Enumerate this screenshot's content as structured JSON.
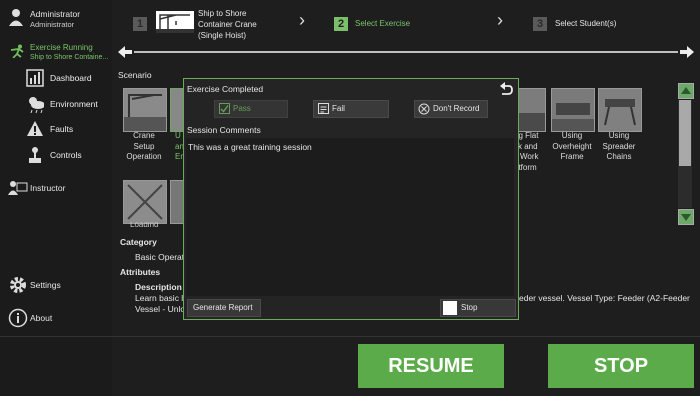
{
  "user": {
    "name": "Administrator",
    "role": "Administrator"
  },
  "status": {
    "label": "Exercise Running",
    "detail": "Ship to Shore Containe..."
  },
  "sidebar": {
    "dashboard": "Dashboard",
    "environment": "Environment",
    "faults": "Faults",
    "controls": "Controls",
    "instructor": "Instructor",
    "settings": "Settings",
    "about": "About"
  },
  "wizard": {
    "step1": {
      "num": "1",
      "line1": "Ship to Shore",
      "line2": "Container Crane",
      "line3": "(Single Hoist)"
    },
    "step2": {
      "num": "2",
      "label": "Select Exercise"
    },
    "step3": {
      "num": "3",
      "label": "Select Student(s)"
    }
  },
  "scenario_label": "Scenario",
  "thumbnails": {
    "crane": {
      "l1": "Crane",
      "l2": "Setup",
      "l3": "Operation"
    },
    "flat": {
      "l1": "ng Flat",
      "l2": "ck and",
      "l3": "Work",
      "l4": "atform"
    },
    "overheight": {
      "l1": "Using",
      "l2": "Overheight",
      "l3": "Frame"
    },
    "spreader": {
      "l1": "Using",
      "l2": "Spreader",
      "l3": "Chains"
    },
    "frag1": "U",
    "frag2": "an",
    "frag3": "En",
    "loading": "Loading"
  },
  "details": {
    "category_label": "Category",
    "category_value": "Basic Operati",
    "attributes_label": "Attributes",
    "description_label": "Description",
    "description_line1": "Learn basic lo",
    "description_line2": "Vessel - Unloa",
    "description_right": "eder vessel. Vessel Type: Feeder (A2-Feeder"
  },
  "dialog": {
    "title": "Exercise Completed",
    "pass": "Pass",
    "fail": "Fail",
    "dont_record": "Don't Record",
    "comments_label": "Session Comments",
    "comments_text": "This was a great training session",
    "generate_report": "Generate Report",
    "stop": "Stop"
  },
  "buttons": {
    "resume": "RESUME",
    "stop": "STOP"
  },
  "colors": {
    "accent_green": "#5cab4a",
    "active_step": "#7bbf6a",
    "dialog_border": "#6cab5c"
  }
}
